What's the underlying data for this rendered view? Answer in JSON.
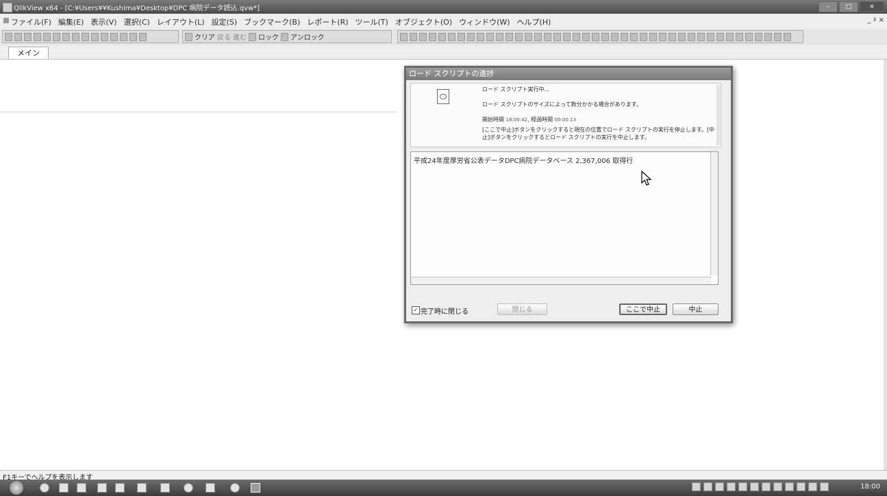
{
  "window": {
    "title": "QlikView x64 - [C:¥Users¥¥Kushima¥Desktop¥DPC 病院データ読込.qvw*]"
  },
  "menubar": {
    "items": [
      "ファイル(F)",
      "編集(E)",
      "表示(V)",
      "選択(C)",
      "レイアウト(L)",
      "設定(S)",
      "ブックマーク(B)",
      "レポート(R)",
      "ツール(T)",
      "オブジェクト(O)",
      "ウィンドウ(W)",
      "ヘルプ(H)"
    ],
    "mdi_controls": "_ ♯ ×"
  },
  "toolbar": {
    "clear_label": "クリア",
    "back_label": "戻る",
    "forward_label": "進む",
    "lock_label": "ロック",
    "unlock_label": "アンロック"
  },
  "tabs": [
    {
      "label": "メイン"
    }
  ],
  "status": {
    "text": "F1キーでヘルプを表示します"
  },
  "taskbar": {
    "clock": "18:00"
  },
  "dialog": {
    "title": "ロード スクリプトの進捗",
    "line1": "ロード スクリプト実行中...",
    "line2": "ロード スクリプトのサイズによって数分かかる場合があります。",
    "start_label": "開始時間",
    "start_time": "18:00:42",
    "elapsed_label": "経過時間",
    "elapsed_time": "00:00:13",
    "instructions": "[ここで中止]ボタンをクリックすると現在の位置でロード スクリプトの実行を停止します。[中止]ボタンをクリックするとロード スクリプトの実行を中止します。",
    "log": {
      "text": "平成24年度厚労省公表データDPC病院データベース",
      "count": "2,367,006",
      "unit": "取得行"
    },
    "close_on_finish_label": "完了時に閉じる",
    "close_on_finish_checked": true,
    "buttons": {
      "close": "閉じる",
      "stop_here": "ここで中止",
      "abort": "中止"
    }
  },
  "icons": [
    "app-icon",
    "minimize-icon",
    "maximize-icon",
    "close-icon",
    "document-icon",
    "mouse-cursor-icon",
    "start-icon"
  ]
}
